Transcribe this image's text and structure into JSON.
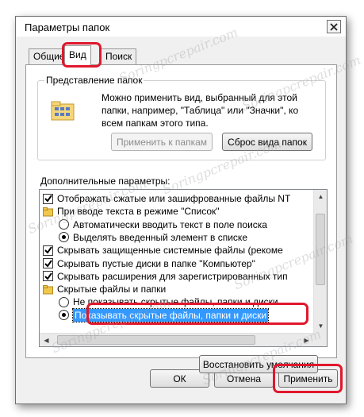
{
  "window": {
    "title": "Параметры папок"
  },
  "tabs": [
    {
      "label": "Общие"
    },
    {
      "label": "Вид"
    },
    {
      "label": "Поиск"
    }
  ],
  "folder_views": {
    "group_label": "Представление папок",
    "description": "Можно применить вид, выбранный для этой папки, например, \"Таблица\" или \"Значки\", ко всем папкам этого типа.",
    "apply_button": "Применить к папкам",
    "reset_button": "Сброс вида папок"
  },
  "advanced": {
    "label": "Дополнительные параметры:",
    "items": [
      {
        "type": "checkbox",
        "checked": true,
        "label": "Отображать сжатые или зашифрованные файлы NT"
      },
      {
        "type": "folder",
        "label": "При вводе текста в режиме \"Список\""
      },
      {
        "type": "radio",
        "checked": false,
        "label": "Автоматически вводить текст в поле поиска"
      },
      {
        "type": "radio",
        "checked": true,
        "label": "Выделять введенный элемент в списке"
      },
      {
        "type": "checkbox",
        "checked": true,
        "label": "Скрывать защищенные системные файлы (рекоме"
      },
      {
        "type": "checkbox",
        "checked": true,
        "label": "Скрывать пустые диски в папке \"Компьютер\""
      },
      {
        "type": "checkbox",
        "checked": true,
        "label": "Скрывать расширения для зарегистрированных тип"
      },
      {
        "type": "folder",
        "label": "Скрытые файлы и папки"
      },
      {
        "type": "radio",
        "checked": false,
        "label": "Не показывать скрытые файлы, папки и диски"
      },
      {
        "type": "radio",
        "checked": true,
        "selected": true,
        "label": "Показывать скрытые файлы, папки и диски"
      }
    ],
    "restore_button": "Восстановить умолчания"
  },
  "footer": {
    "ok": "ОК",
    "cancel": "Отмена",
    "apply": "Применить"
  },
  "watermark": "Soringpcrepair.com",
  "colors": {
    "highlight_ring": "#e0182d",
    "selection": "#3399ff"
  }
}
